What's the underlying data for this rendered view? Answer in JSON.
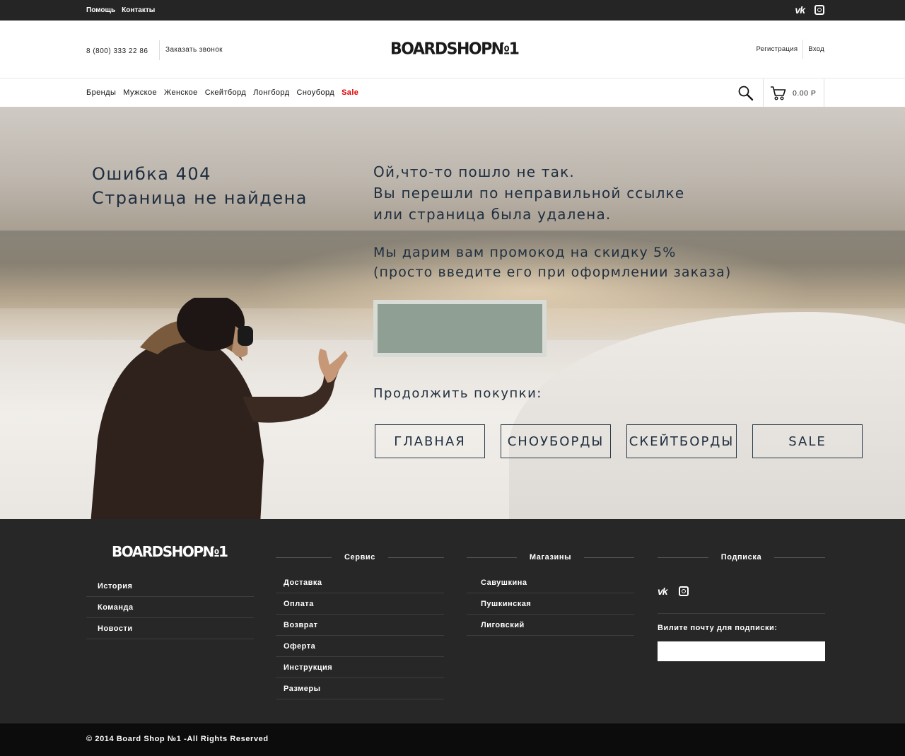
{
  "topbar": {
    "links": [
      "Помощь",
      "Контакты"
    ],
    "social": [
      "vk-icon",
      "instagram-icon"
    ]
  },
  "header": {
    "phone": "8 (800) 333 22 86",
    "callback": "Заказать звонок",
    "logo": "BOARDSHOP№1",
    "register": "Регистрация",
    "login": "Вход"
  },
  "nav": {
    "items": [
      "Бренды",
      "Мужское",
      "Женское",
      "Скейтборд",
      "Лонгборд",
      "Сноуборд"
    ],
    "sale": "Sale",
    "cart_total": "0.00 Р"
  },
  "hero": {
    "error_line1": "Ошибка 404",
    "error_line2": "Страница не найдена",
    "message_line1": "Ой,что-то пошло не так.",
    "message_line2": "Вы перешли по неправильной ссылке",
    "message_line3": "или страница была удалена.",
    "promo_line1": "Мы дарим вам промокод на скидку 5%",
    "promo_line2": "(просто введите его при оформлении заказа)",
    "continue": "Продолжить покупки:",
    "buttons": [
      "ГЛАВНАЯ",
      "СНОУБОРДЫ",
      "СКЕЙТБОРДЫ",
      "SALE"
    ]
  },
  "footer": {
    "logo": "BOARDSHOP№1",
    "about": [
      "История",
      "Команда",
      "Новости"
    ],
    "service_title": "Сервис",
    "service": [
      "Доставка",
      "Оплата",
      "Возврат",
      "Оферта",
      "Инструкция",
      "Размеры"
    ],
    "stores_title": "Магазины",
    "stores": [
      "Савушкина",
      "Пушкинская",
      "Лиговский"
    ],
    "subscribe_title": "Подписка",
    "subscribe_label": "Вилите почту для подписки:",
    "copyright": "© 2014 Board Shop №1 -All Rights Reserved"
  },
  "colors": {
    "topbar": "#252525",
    "footer": "#272727",
    "sale": "#dd0000",
    "hero_text": "#1e2e3f"
  }
}
